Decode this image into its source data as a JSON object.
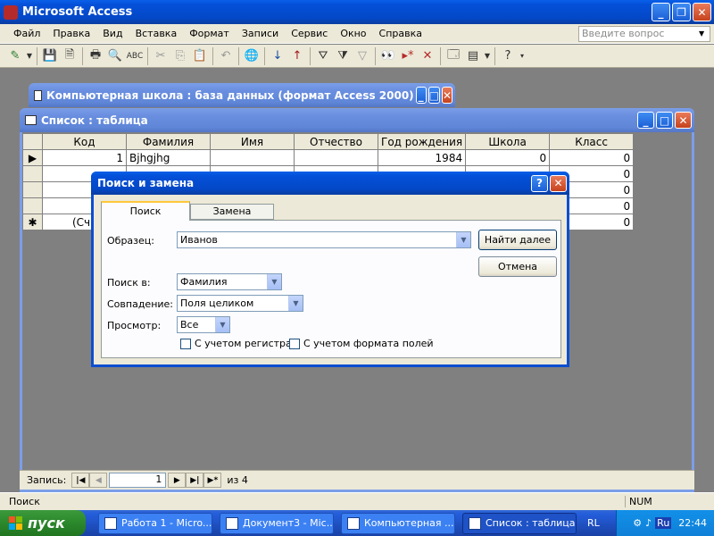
{
  "app": {
    "title": "Microsoft Access",
    "help_placeholder": "Введите вопрос"
  },
  "menu": [
    "Файл",
    "Правка",
    "Вид",
    "Вставка",
    "Формат",
    "Записи",
    "Сервис",
    "Окно",
    "Справка"
  ],
  "db_window": {
    "title": "Компьютерная школа : база данных (формат Access 2000)"
  },
  "table_window": {
    "title": "Список : таблица"
  },
  "table": {
    "columns": [
      "Код",
      "Фамилия",
      "Имя",
      "Отчество",
      "Год рождения",
      "Школа",
      "Класс"
    ],
    "row1": {
      "kod": "1",
      "fam": "Bjhgjhg",
      "imya": "",
      "otch": "",
      "god": "1984",
      "shkola": "0",
      "klass": "0"
    },
    "partial_new": "(Сч",
    "extra_klass": [
      "0",
      "0",
      "0",
      "0"
    ]
  },
  "record_nav": {
    "label": "Запись:",
    "current": "1",
    "of": "из  4"
  },
  "dialog": {
    "title": "Поиск и замена",
    "tab_find": "Поиск",
    "tab_replace": "Замена",
    "pattern_label": "Образец:",
    "pattern_value": "Иванов",
    "find_next": "Найти далее",
    "cancel": "Отмена",
    "search_in_label": "Поиск в:",
    "search_in_value": "Фамилия",
    "match_label": "Совпадение:",
    "match_value": "Поля целиком",
    "view_label": "Просмотр:",
    "view_value": "Все",
    "match_case": "С учетом регистра",
    "match_format": "С учетом формата полей"
  },
  "status": {
    "left": "Поиск",
    "num": "NUM"
  },
  "taskbar": {
    "start": "пуск",
    "tasks": [
      "Работа 1 - Micro...",
      "Документ3 - Mic...",
      "Компьютерная ...",
      "Список : таблица"
    ],
    "lang": "RL",
    "lang2": "Ru",
    "clock": "22:44"
  }
}
